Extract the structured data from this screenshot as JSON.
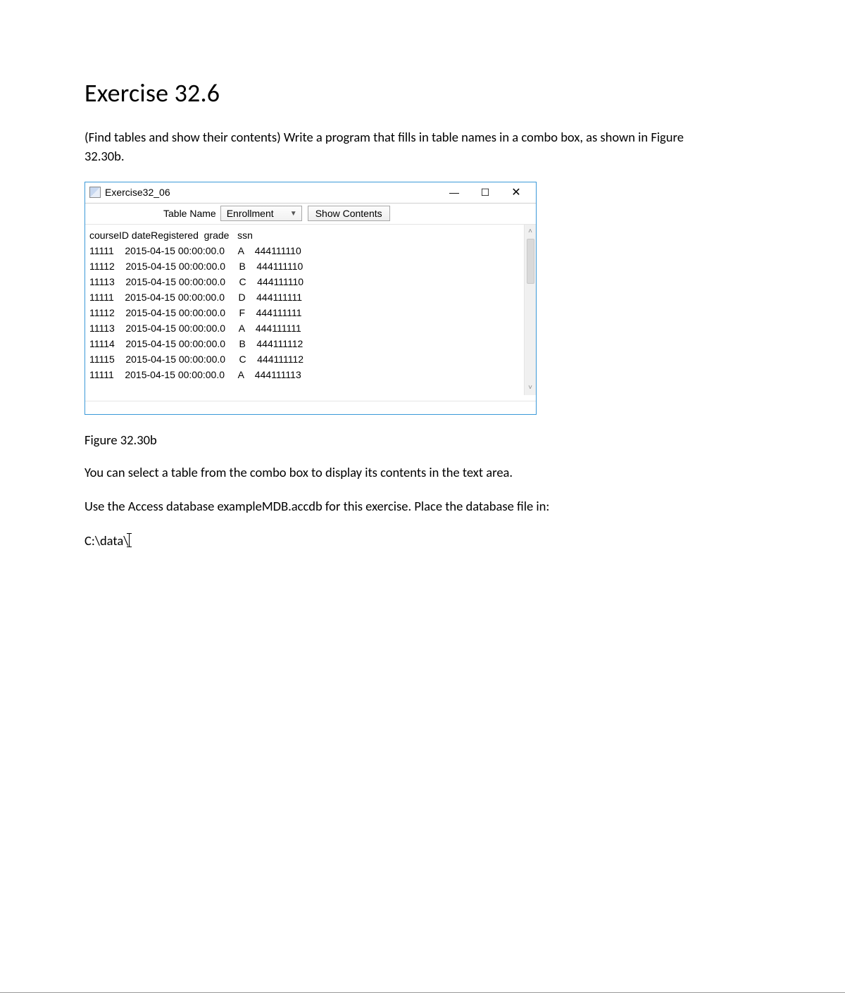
{
  "heading": "Exercise 32.6",
  "intro": "(Find tables and show their contents)  Write a program that fills in table names in a combo box, as shown in Figure 32.30b.",
  "figure": {
    "caption": "Figure 32.30b",
    "window_title": "Exercise32_06",
    "toolbar": {
      "label": "Table Name",
      "combo_value": "Enrollment",
      "button_label": "Show Contents"
    },
    "columns": [
      "courseID",
      "dateRegistered",
      "grade",
      "ssn"
    ],
    "rows": [
      {
        "courseID": "11111",
        "dateRegistered": "2015-04-15 00:00:00.0",
        "grade": "A",
        "ssn": "444111110"
      },
      {
        "courseID": "11112",
        "dateRegistered": "2015-04-15 00:00:00.0",
        "grade": "B",
        "ssn": "444111110"
      },
      {
        "courseID": "11113",
        "dateRegistered": "2015-04-15 00:00:00.0",
        "grade": "C",
        "ssn": "444111110"
      },
      {
        "courseID": "11111",
        "dateRegistered": "2015-04-15 00:00:00.0",
        "grade": "D",
        "ssn": "444111111"
      },
      {
        "courseID": "11112",
        "dateRegistered": "2015-04-15 00:00:00.0",
        "grade": "F",
        "ssn": "444111111"
      },
      {
        "courseID": "11113",
        "dateRegistered": "2015-04-15 00:00:00.0",
        "grade": "A",
        "ssn": "444111111"
      },
      {
        "courseID": "11114",
        "dateRegistered": "2015-04-15 00:00:00.0",
        "grade": "B",
        "ssn": "444111112"
      },
      {
        "courseID": "11115",
        "dateRegistered": "2015-04-15 00:00:00.0",
        "grade": "C",
        "ssn": "444111112"
      },
      {
        "courseID": "11111",
        "dateRegistered": "2015-04-15 00:00:00.0",
        "grade": "A",
        "ssn": "444111113"
      }
    ]
  },
  "after1": "You can select a table from the combo box to display its contents in the text area.",
  "after2": "Use the Access database exampleMDB.accdb for this exercise.  Place the database file in:",
  "path": "C:\\data\\"
}
